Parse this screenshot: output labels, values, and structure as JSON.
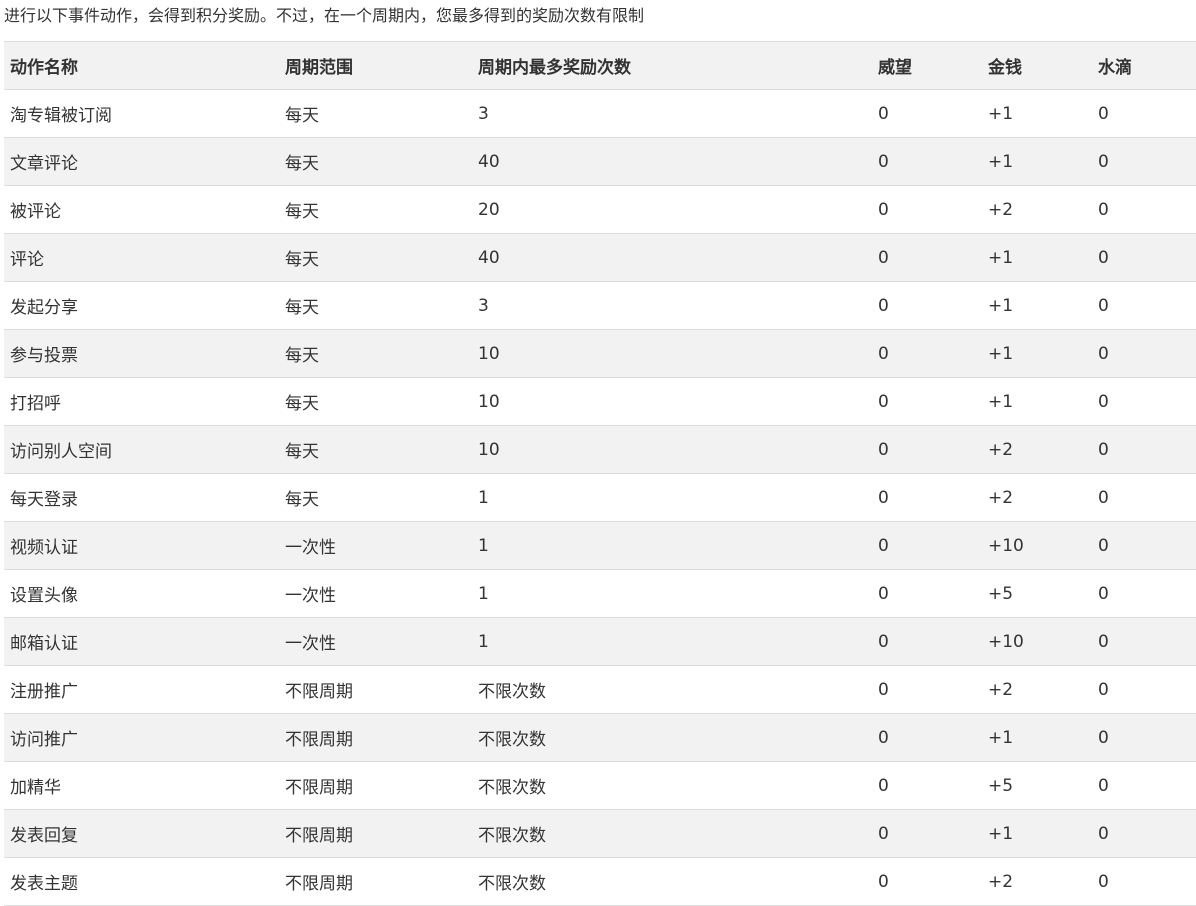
{
  "intro": "进行以下事件动作，会得到积分奖励。不过，在一个周期内，您最多得到的奖励次数有限制",
  "table": {
    "headers": [
      "动作名称",
      "周期范围",
      "周期内最多奖励次数",
      "威望",
      "金钱",
      "水滴"
    ],
    "rows": [
      [
        "淘专辑被订阅",
        "每天",
        "3",
        "0",
        "+1",
        "0"
      ],
      [
        "文章评论",
        "每天",
        "40",
        "0",
        "+1",
        "0"
      ],
      [
        "被评论",
        "每天",
        "20",
        "0",
        "+2",
        "0"
      ],
      [
        "评论",
        "每天",
        "40",
        "0",
        "+1",
        "0"
      ],
      [
        "发起分享",
        "每天",
        "3",
        "0",
        "+1",
        "0"
      ],
      [
        "参与投票",
        "每天",
        "10",
        "0",
        "+1",
        "0"
      ],
      [
        "打招呼",
        "每天",
        "10",
        "0",
        "+1",
        "0"
      ],
      [
        "访问别人空间",
        "每天",
        "10",
        "0",
        "+2",
        "0"
      ],
      [
        "每天登录",
        "每天",
        "1",
        "0",
        "+2",
        "0"
      ],
      [
        "视频认证",
        "一次性",
        "1",
        "0",
        "+10",
        "0"
      ],
      [
        "设置头像",
        "一次性",
        "1",
        "0",
        "+5",
        "0"
      ],
      [
        "邮箱认证",
        "一次性",
        "1",
        "0",
        "+10",
        "0"
      ],
      [
        "注册推广",
        "不限周期",
        "不限次数",
        "0",
        "+2",
        "0"
      ],
      [
        "访问推广",
        "不限周期",
        "不限次数",
        "0",
        "+1",
        "0"
      ],
      [
        "加精华",
        "不限周期",
        "不限次数",
        "0",
        "+5",
        "0"
      ],
      [
        "发表回复",
        "不限周期",
        "不限次数",
        "0",
        "+1",
        "0"
      ],
      [
        "发表主题",
        "不限周期",
        "不限次数",
        "0",
        "+2",
        "0"
      ]
    ]
  }
}
